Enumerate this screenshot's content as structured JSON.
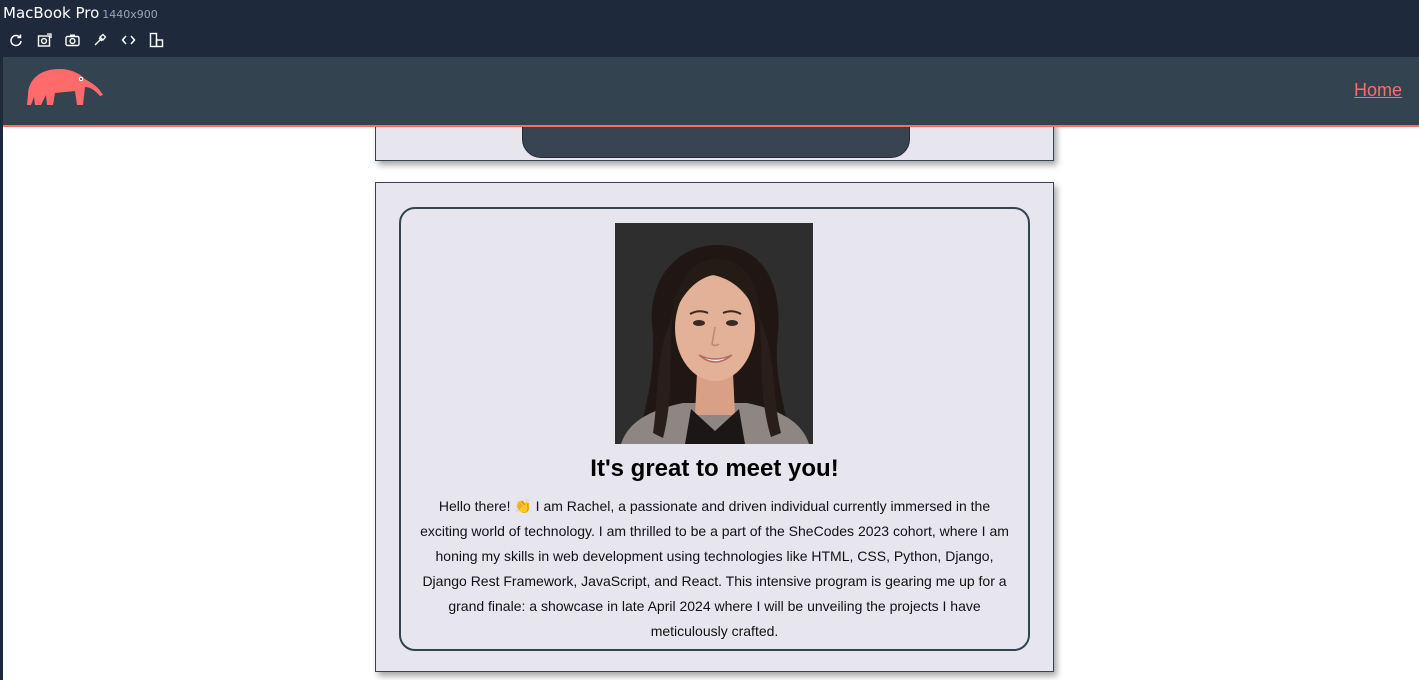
{
  "device": {
    "name": "MacBook Pro",
    "resolution": "1440x900",
    "tools": [
      {
        "icon": "refresh-icon"
      },
      {
        "icon": "screenshot-full-icon"
      },
      {
        "icon": "camera-icon"
      },
      {
        "icon": "eyedropper-icon"
      },
      {
        "icon": "code-icon"
      },
      {
        "icon": "layout-icon"
      }
    ]
  },
  "nav": {
    "logo": "anteater-logo",
    "home_label": "Home"
  },
  "about": {
    "heading": "It's great to meet you!",
    "bio": "Hello there! 👏 I am Rachel, a passionate and driven individual currently immersed in the exciting world of technology. I am thrilled to be a part of the SheCodes 2023 cohort, where I am honing my skills in web development using technologies like HTML, CSS, Python, Django, Django Rest Framework, JavaScript, and React. This intensive program is gearing me up for a grand finale: a showcase in late April 2024 where I will be unveiling the projects I have meticulously crafted."
  },
  "colors": {
    "device_bar": "#1e293b",
    "nav_bg": "#334350",
    "accent": "#ff6b6b",
    "card_bg": "#e7e6ee"
  }
}
